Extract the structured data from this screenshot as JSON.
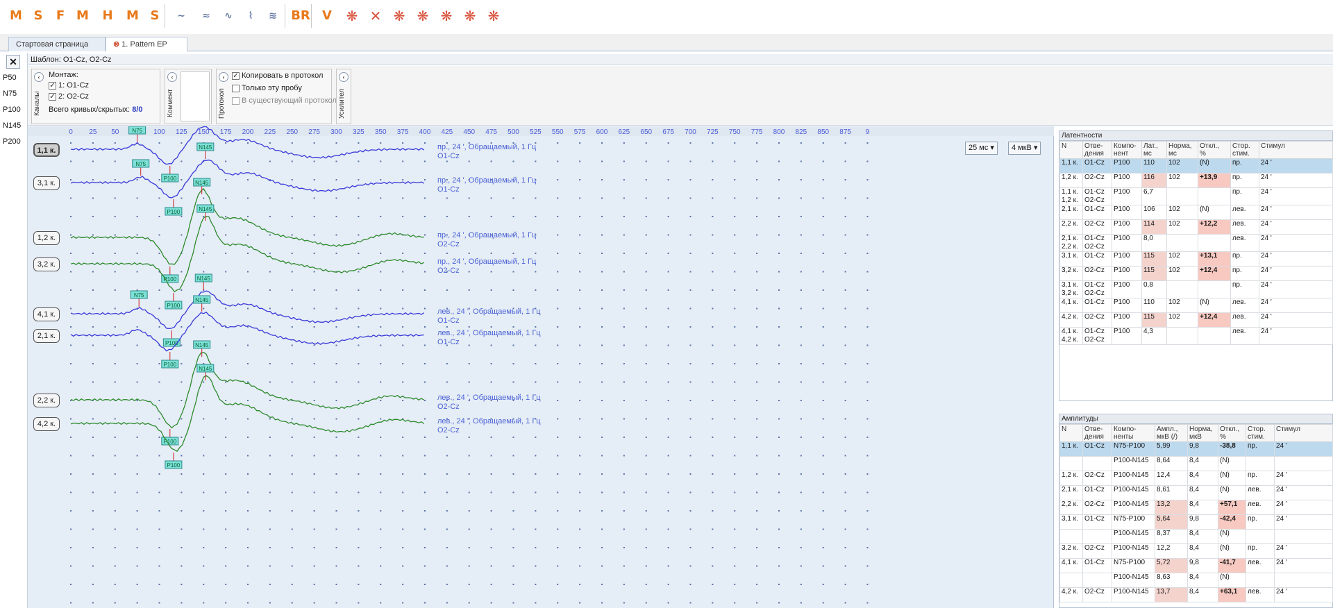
{
  "toolbar": {
    "buttons": [
      {
        "glyph": "M",
        "icon": "motor-ep-icon"
      },
      {
        "glyph": "S",
        "icon": "sensory-ep-icon"
      },
      {
        "glyph": "F",
        "icon": "f-wave-icon"
      },
      {
        "glyph": "M",
        "icon": "magnetic-stim-icon"
      },
      {
        "glyph": "H",
        "icon": "h-reflex-icon"
      },
      {
        "glyph": "M",
        "icon": "motor-unit-icon"
      },
      {
        "glyph": "S",
        "icon": "sensory-unit-icon"
      },
      {
        "glyph": "~",
        "icon": "wave-icon"
      },
      {
        "glyph": "≈",
        "icon": "emg-icon"
      },
      {
        "glyph": "∿",
        "icon": "emg2-icon"
      },
      {
        "glyph": "⌇",
        "icon": "emg3-icon"
      },
      {
        "glyph": "≋",
        "icon": "emg4-icon"
      },
      {
        "glyph": "BR",
        "icon": "blink-reflex-icon"
      },
      {
        "glyph": "V",
        "icon": "vep-icon"
      },
      {
        "glyph": "❋",
        "icon": "brain-ep-icon"
      },
      {
        "glyph": "✕",
        "icon": "brain-pattern-icon"
      },
      {
        "glyph": "❋",
        "icon": "brain-flash-icon"
      },
      {
        "glyph": "❋",
        "icon": "brain-aep-icon"
      },
      {
        "glyph": "❋",
        "icon": "brain-ssep-icon"
      },
      {
        "glyph": "❋",
        "icon": "brain-p300-icon"
      },
      {
        "glyph": "❋",
        "icon": "brain-cnv-icon"
      }
    ]
  },
  "tabs": [
    {
      "label": "Стартовая страница"
    },
    {
      "label": "1. Pattern EP"
    }
  ],
  "left_labels": [
    "P50",
    "N75",
    "P100",
    "N145",
    "P200"
  ],
  "template": "Шаблон: O1-Cz, O2-Cz",
  "channels_panel": {
    "title": "Каналы",
    "montage": "Монтаж:",
    "items": [
      "1: O1-Cz",
      "2: O2-Cz"
    ],
    "total_label": "Всего кривых/скрытых:",
    "total_value": "8/0"
  },
  "comment_panel": {
    "title": "Коммент"
  },
  "protocol_panel": {
    "title": "Протокол",
    "options": [
      {
        "label": "Копировать в протокол",
        "checked": true
      },
      {
        "label": "Только эту пробу",
        "checked": false
      },
      {
        "label": "В существующий протокол",
        "checked": false
      }
    ]
  },
  "amp_panel": {
    "title": "Усилител"
  },
  "plot": {
    "scale_time": "25 мс",
    "scale_amp": "4 мкВ",
    "ruler_ticks": [
      "0",
      "25",
      "50",
      "75",
      "100",
      "125",
      "150",
      "175",
      "200",
      "225",
      "250",
      "275",
      "300",
      "325",
      "350",
      "375",
      "400",
      "425",
      "450",
      "475",
      "500",
      "525",
      "550",
      "575",
      "600",
      "625",
      "650",
      "675",
      "700",
      "725",
      "750",
      "775",
      "800",
      "825",
      "850",
      "875",
      "9"
    ],
    "traces": [
      {
        "label": "1,1 к.",
        "color": "#3838d8",
        "info": "пр., 24 ', Обращаемый, 1 Гц",
        "lead": "O1-Cz",
        "markers": [
          "N75",
          "P100",
          "N145"
        ],
        "selected": true
      },
      {
        "label": "3,1 к.",
        "color": "#3838d8",
        "info": "пр., 24 ', Обращаемый, 1 Гц",
        "lead": "O1-Cz",
        "markers": [
          "N75",
          "P100",
          "N145"
        ],
        "selected": false
      },
      {
        "label": "1,2 к.",
        "color": "#2d8a2d",
        "info": "пр., 24 ', Обращаемый, 1 Гц",
        "lead": "O2-Cz",
        "markers": [
          "P100",
          "N145"
        ],
        "selected": false
      },
      {
        "label": "3,2 к.",
        "color": "#2d8a2d",
        "info": "пр., 24 ', Обращаемый, 1 Гц",
        "lead": "O2-Cz",
        "markers": [
          "P100",
          "N145"
        ],
        "selected": false
      },
      {
        "label": "4,1 к.",
        "color": "#3838d8",
        "info": "лев., 24 ', Обращаемый, 1 Гц",
        "lead": "O1-Cz",
        "markers": [
          "N75",
          "P100",
          "N145"
        ],
        "selected": false
      },
      {
        "label": "2,1 к.",
        "color": "#3838d8",
        "info": "лев., 24 ', Обращаемый, 1 Гц",
        "lead": "O1-Cz",
        "markers": [
          "P100",
          "N145"
        ],
        "selected": false
      },
      {
        "label": "2,2 к.",
        "color": "#2d8a2d",
        "info": "лев., 24 ', Обращаемый, 1 Гц",
        "lead": "O2-Cz",
        "markers": [
          "P100",
          "N145"
        ],
        "selected": false
      },
      {
        "label": "4,2 к.",
        "color": "#2d8a2d",
        "info": "лев., 24 ', Обращаемый, 1 Гц",
        "lead": "O2-Cz",
        "markers": [
          "P100",
          "N145"
        ],
        "selected": false
      }
    ]
  },
  "latency_table": {
    "title": "Латентности",
    "headers": [
      "N",
      "Отве-\nдения",
      "Компо-\nнент",
      "Лат.,\nмс",
      "Норма,\nмс",
      "Откл.,\n%",
      "Стор.\nстим.",
      "Стимул"
    ],
    "rows": [
      {
        "n": "1,1 к.",
        "lead": "O1-Cz",
        "comp": "P100",
        "lat": "110",
        "norm": "102",
        "dev": "(N)",
        "side": "пр.",
        "stim": "24 '",
        "sel": true,
        "red": false
      },
      {
        "n": "1,2 к.",
        "lead": "O2-Cz",
        "comp": "P100",
        "lat": "116",
        "norm": "102",
        "dev": "+13,9",
        "side": "пр.",
        "stim": "24 '",
        "sel": false,
        "red": true
      },
      {
        "n": "1,1 к.\n1,2 к.",
        "lead": "O1-Cz\nO2-Cz",
        "comp": "P100",
        "lat": "6,7",
        "norm": "",
        "dev": "",
        "side": "пр.",
        "stim": "24 '",
        "sel": false,
        "red": false
      },
      {
        "n": "2,1 к.",
        "lead": "O1-Cz",
        "comp": "P100",
        "lat": "106",
        "norm": "102",
        "dev": "(N)",
        "side": "лев.",
        "stim": "24 '",
        "sel": false,
        "red": false
      },
      {
        "n": "2,2 к.",
        "lead": "O2-Cz",
        "comp": "P100",
        "lat": "114",
        "norm": "102",
        "dev": "+12,2",
        "side": "лев.",
        "stim": "24 '",
        "sel": false,
        "red": true
      },
      {
        "n": "2,1 к.\n2,2 к.",
        "lead": "O1-Cz\nO2-Cz",
        "comp": "P100",
        "lat": "8,0",
        "norm": "",
        "dev": "",
        "side": "лев.",
        "stim": "24 '",
        "sel": false,
        "red": false
      },
      {
        "n": "3,1 к.",
        "lead": "O1-Cz",
        "comp": "P100",
        "lat": "115",
        "norm": "102",
        "dev": "+13,1",
        "side": "пр.",
        "stim": "24 '",
        "sel": false,
        "red": true
      },
      {
        "n": "3,2 к.",
        "lead": "O2-Cz",
        "comp": "P100",
        "lat": "115",
        "norm": "102",
        "dev": "+12,4",
        "side": "пр.",
        "stim": "24 '",
        "sel": false,
        "red": true
      },
      {
        "n": "3,1 к.\n3,2 к.",
        "lead": "O1-Cz\nO2-Cz",
        "comp": "P100",
        "lat": "0,8",
        "norm": "",
        "dev": "",
        "side": "пр.",
        "stim": "24 '",
        "sel": false,
        "red": false
      },
      {
        "n": "4,1 к.",
        "lead": "O1-Cz",
        "comp": "P100",
        "lat": "110",
        "norm": "102",
        "dev": "(N)",
        "side": "лев.",
        "stim": "24 '",
        "sel": false,
        "red": false
      },
      {
        "n": "4,2 к.",
        "lead": "O2-Cz",
        "comp": "P100",
        "lat": "115",
        "norm": "102",
        "dev": "+12,4",
        "side": "лев.",
        "stim": "24 '",
        "sel": false,
        "red": true
      },
      {
        "n": "4,1 к.\n4,2 к.",
        "lead": "O1-Cz\nO2-Cz",
        "comp": "P100",
        "lat": "4,3",
        "norm": "",
        "dev": "",
        "side": "лев.",
        "stim": "24 '",
        "sel": false,
        "red": false
      }
    ]
  },
  "amplitude_table": {
    "title": "Амплитуды",
    "headers": [
      "N",
      "Отве-\nдения",
      "Компо-\nненты",
      "Ампл.,\nмкВ (/)",
      "Норма,\nмкВ",
      "Откл.,\n%",
      "Стор.\nстим.",
      "Стимул"
    ],
    "rows": [
      {
        "n": "1,1 к.",
        "lead": "O1-Cz",
        "comp": "N75-P100",
        "amp": "5,99",
        "norm": "9,8",
        "dev": "-38,8",
        "side": "пр.",
        "stim": "24 '",
        "sel": true,
        "red": true
      },
      {
        "n": "",
        "lead": "",
        "comp": "P100-N145",
        "amp": "8,64",
        "norm": "8,4",
        "dev": "(N)",
        "side": "",
        "stim": "",
        "sel": false,
        "red": false
      },
      {
        "n": "1,2 к.",
        "lead": "O2-Cz",
        "comp": "P100-N145",
        "amp": "12,4",
        "norm": "8,4",
        "dev": "(N)",
        "side": "пр.",
        "stim": "24 '",
        "sel": false,
        "red": false
      },
      {
        "n": "2,1 к.",
        "lead": "O1-Cz",
        "comp": "P100-N145",
        "amp": "8,61",
        "norm": "8,4",
        "dev": "(N)",
        "side": "лев.",
        "stim": "24 '",
        "sel": false,
        "red": false
      },
      {
        "n": "2,2 к.",
        "lead": "O2-Cz",
        "comp": "P100-N145",
        "amp": "13,2",
        "norm": "8,4",
        "dev": "+57,1",
        "side": "лев.",
        "stim": "24 '",
        "sel": false,
        "red": true
      },
      {
        "n": "3,1 к.",
        "lead": "O1-Cz",
        "comp": "N75-P100",
        "amp": "5,64",
        "norm": "9,8",
        "dev": "-42,4",
        "side": "пр.",
        "stim": "24 '",
        "sel": false,
        "red": true
      },
      {
        "n": "",
        "lead": "",
        "comp": "P100-N145",
        "amp": "8,37",
        "norm": "8,4",
        "dev": "(N)",
        "side": "",
        "stim": "",
        "sel": false,
        "red": false
      },
      {
        "n": "3,2 к.",
        "lead": "O2-Cz",
        "comp": "P100-N145",
        "amp": "12,2",
        "norm": "8,4",
        "dev": "(N)",
        "side": "пр.",
        "stim": "24 '",
        "sel": false,
        "red": false
      },
      {
        "n": "4,1 к.",
        "lead": "O1-Cz",
        "comp": "N75-P100",
        "amp": "5,72",
        "norm": "9,8",
        "dev": "-41,7",
        "side": "лев.",
        "stim": "24 '",
        "sel": false,
        "red": true
      },
      {
        "n": "",
        "lead": "",
        "comp": "P100-N145",
        "amp": "8,63",
        "norm": "8,4",
        "dev": "(N)",
        "side": "",
        "stim": "",
        "sel": false,
        "red": false
      },
      {
        "n": "4,2 к.",
        "lead": "O2-Cz",
        "comp": "P100-N145",
        "amp": "13,7",
        "norm": "8,4",
        "dev": "+63,1",
        "side": "лев.",
        "stim": "24 '",
        "sel": false,
        "red": true
      }
    ]
  }
}
